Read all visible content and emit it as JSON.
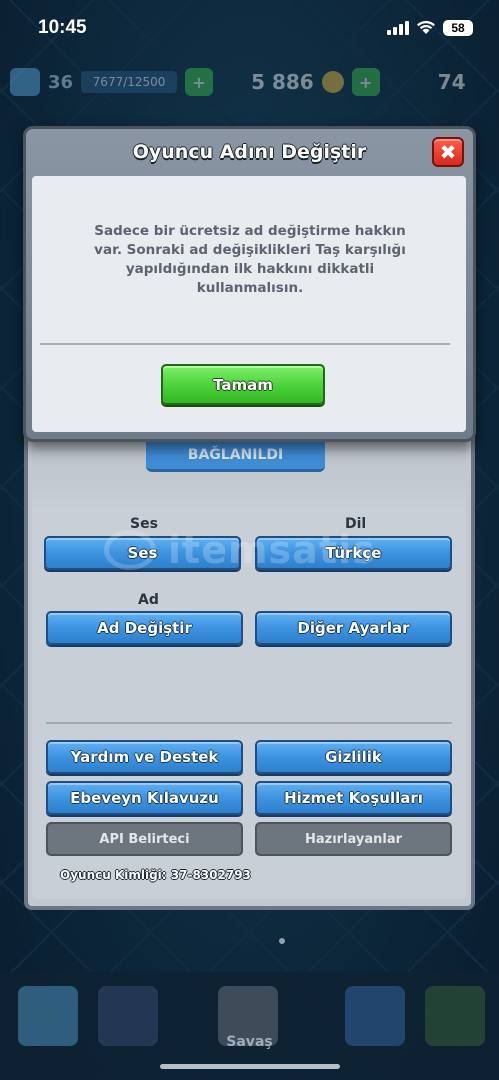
{
  "status_bar": {
    "time": "10:45",
    "battery": "58"
  },
  "hud": {
    "level": "36",
    "xp": "7677/12500",
    "gold": "5 886",
    "gems": "74"
  },
  "modal": {
    "title": "Oyuncu Adını Değiştir",
    "close_symbol": "✖",
    "message": "Sadece bir ücretsiz ad değiştirme hakkın var. Sonraki ad değişiklikleri Taş karşılığı yapıldığından ilk hakkını dikkatli kullanmalısın.",
    "ok_label": "Tamam"
  },
  "settings": {
    "connected_label": "BAĞLANILDI",
    "sound_section": "Ses",
    "language_section": "Dil",
    "sound_button": "Ses",
    "language_button": "Türkçe",
    "name_section": "Ad",
    "change_name_button": "Ad Değiştir",
    "other_settings_button": "Diğer Ayarlar",
    "help_button": "Yardım ve Destek",
    "privacy_button": "Gizlilik",
    "parents_guide_button": "Ebeveyn Kılavuzu",
    "terms_button": "Hizmet Koşulları",
    "api_token_button": "API Belirteci",
    "credits_button": "Hazırlayanlar",
    "player_tag": "Oyuncu Kimliği: 37-8302793"
  },
  "watermark": "itemsatis",
  "bottom_nav": {
    "active_label": "Savaş"
  },
  "colors": {
    "accent_blue": "#3e93e0",
    "ok_green": "#4fd33c",
    "close_red": "#d62a1e"
  }
}
